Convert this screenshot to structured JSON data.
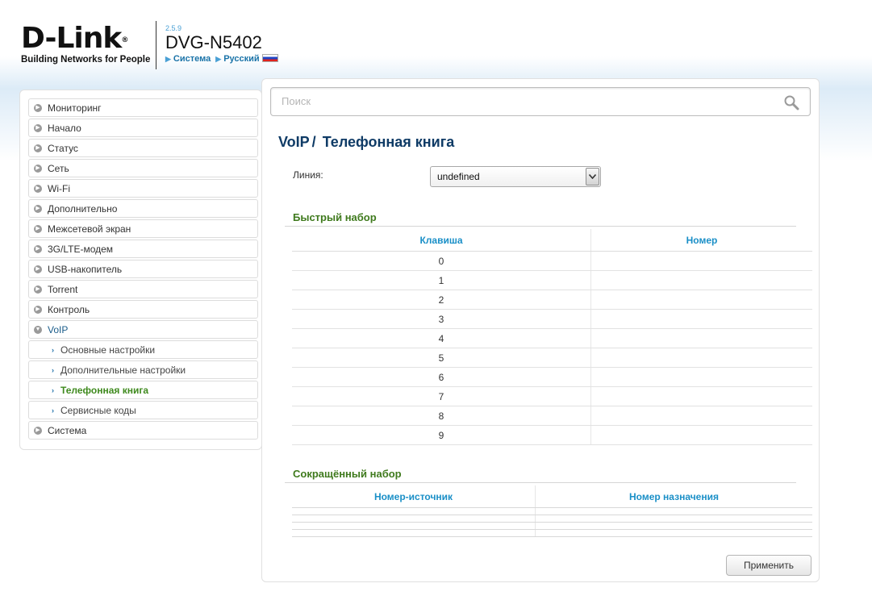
{
  "header": {
    "logo_text": "D-Link",
    "logo_reg": "®",
    "tagline": "Building Networks for People",
    "firmware": "2.5.9",
    "model": "DVG-N5402",
    "crumb_system": "Система",
    "crumb_language": "Русский",
    "flag_icon": "russia-flag-icon"
  },
  "sidebar": {
    "items": [
      {
        "label": "Мониторинг"
      },
      {
        "label": "Начало"
      },
      {
        "label": "Статус"
      },
      {
        "label": "Сеть"
      },
      {
        "label": "Wi-Fi"
      },
      {
        "label": "Дополнительно"
      },
      {
        "label": "Межсетевой экран"
      },
      {
        "label": "3G/LTE-модем"
      },
      {
        "label": "USB-накопитель"
      },
      {
        "label": "Torrent"
      },
      {
        "label": "Контроль"
      },
      {
        "label": "VoIP"
      }
    ],
    "voip_sub": [
      {
        "label": "Основные настройки"
      },
      {
        "label": "Дополнительные настройки"
      },
      {
        "label": "Телефонная книга"
      },
      {
        "label": "Сервисные коды"
      }
    ],
    "last_item": {
      "label": "Система"
    }
  },
  "search": {
    "placeholder": "Поиск",
    "value": ""
  },
  "page": {
    "title_section": "VoIP",
    "title_sep": "/",
    "title_page": "Телефонная книга"
  },
  "line": {
    "label": "Линия:",
    "selected": "undefined"
  },
  "speed_dial": {
    "title": "Быстрый набор",
    "headers": [
      "Клавиша",
      "Номер"
    ],
    "rows": [
      {
        "key": "0",
        "number": ""
      },
      {
        "key": "1",
        "number": ""
      },
      {
        "key": "2",
        "number": ""
      },
      {
        "key": "3",
        "number": ""
      },
      {
        "key": "4",
        "number": ""
      },
      {
        "key": "5",
        "number": ""
      },
      {
        "key": "6",
        "number": ""
      },
      {
        "key": "7",
        "number": ""
      },
      {
        "key": "8",
        "number": ""
      },
      {
        "key": "9",
        "number": ""
      }
    ]
  },
  "short_dial": {
    "title": "Сокращённый набор",
    "headers": [
      "Номер-источник",
      "Номер назначения"
    ]
  },
  "apply_label": "Применить"
}
